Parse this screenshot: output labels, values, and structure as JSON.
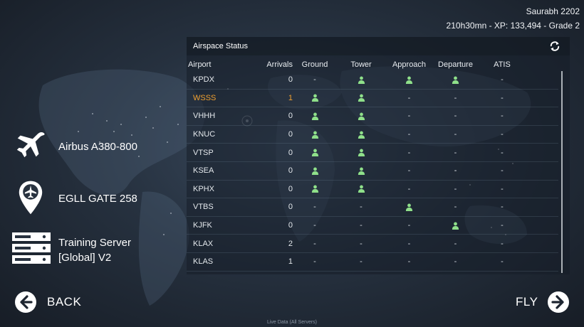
{
  "user": {
    "name": "Saurabh 2202",
    "stats": "210h30mn - XP: 133,494 - Grade 2"
  },
  "panel": {
    "title": "Airspace Status",
    "columns": {
      "airport": "Airport",
      "arrivals": "Arrivals",
      "ground": "Ground",
      "tower": "Tower",
      "approach": "Approach",
      "departure": "Departure",
      "atis": "ATIS"
    },
    "rows": [
      {
        "airport": "KPDX",
        "arrivals": "0",
        "ground": false,
        "tower": true,
        "approach": true,
        "departure": true,
        "atis": false,
        "highlight": false
      },
      {
        "airport": "WSSS",
        "arrivals": "1",
        "ground": true,
        "tower": true,
        "approach": false,
        "departure": false,
        "atis": false,
        "highlight": true
      },
      {
        "airport": "VHHH",
        "arrivals": "0",
        "ground": true,
        "tower": true,
        "approach": false,
        "departure": false,
        "atis": false,
        "highlight": false
      },
      {
        "airport": "KNUC",
        "arrivals": "0",
        "ground": true,
        "tower": true,
        "approach": false,
        "departure": false,
        "atis": false,
        "highlight": false
      },
      {
        "airport": "VTSP",
        "arrivals": "0",
        "ground": true,
        "tower": true,
        "approach": false,
        "departure": false,
        "atis": false,
        "highlight": false
      },
      {
        "airport": "KSEA",
        "arrivals": "0",
        "ground": true,
        "tower": true,
        "approach": false,
        "departure": false,
        "atis": false,
        "highlight": false
      },
      {
        "airport": "KPHX",
        "arrivals": "0",
        "ground": true,
        "tower": true,
        "approach": false,
        "departure": false,
        "atis": false,
        "highlight": false
      },
      {
        "airport": "VTBS",
        "arrivals": "0",
        "ground": false,
        "tower": false,
        "approach": true,
        "departure": false,
        "atis": false,
        "highlight": false
      },
      {
        "airport": "KJFK",
        "arrivals": "0",
        "ground": false,
        "tower": false,
        "approach": false,
        "departure": true,
        "atis": false,
        "highlight": false
      },
      {
        "airport": "KLAX",
        "arrivals": "2",
        "ground": false,
        "tower": false,
        "approach": false,
        "departure": false,
        "atis": false,
        "highlight": false
      },
      {
        "airport": "KLAS",
        "arrivals": "1",
        "ground": false,
        "tower": false,
        "approach": false,
        "departure": false,
        "atis": false,
        "highlight": false
      }
    ],
    "empty_symbol": "-"
  },
  "left": {
    "aircraft": "Airbus A380-800",
    "gate": "EGLL GATE 258",
    "server_line1": "Training Server",
    "server_line2": "[Global] V2"
  },
  "nav": {
    "back": "BACK",
    "fly": "FLY"
  },
  "footer": "Live Data (All Servers)",
  "colors": {
    "active_controller": "#8fe08a",
    "highlight_row": "#f0a030"
  },
  "icons": {
    "aircraft": "airplane-icon",
    "gate": "map-pin-plane-icon",
    "server": "server-icon",
    "refresh": "refresh-icon",
    "controller": "person-icon",
    "back": "arrow-left-circle-icon",
    "fly": "arrow-right-circle-icon"
  }
}
